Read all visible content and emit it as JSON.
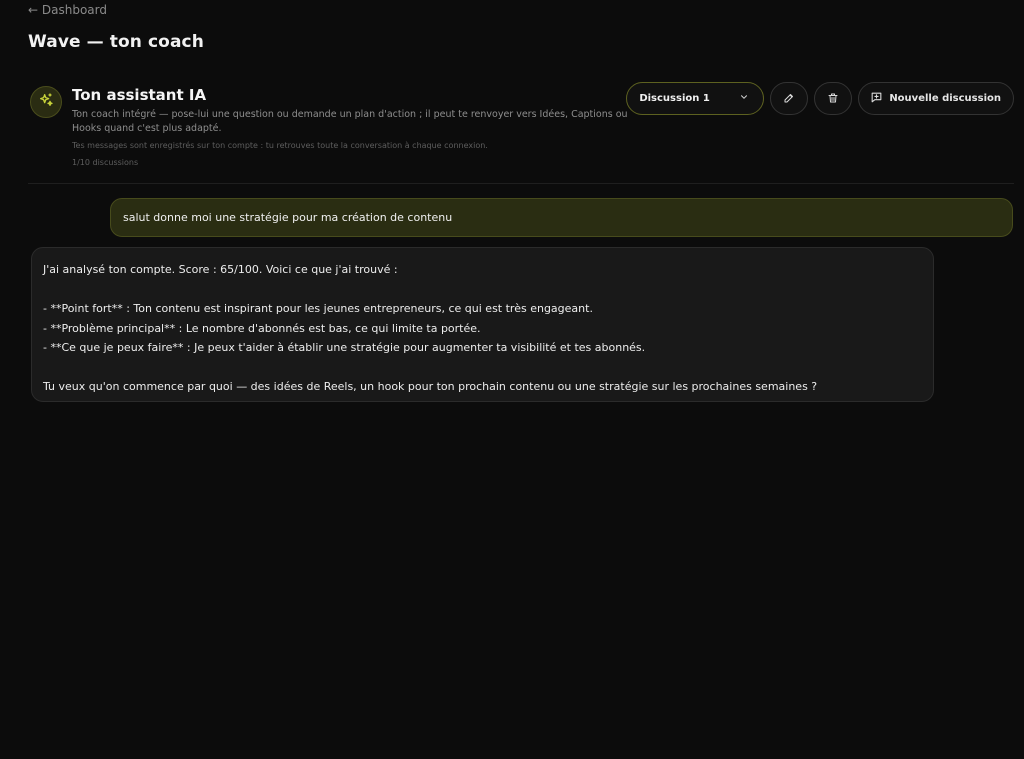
{
  "nav": {
    "back_label": "← Dashboard"
  },
  "page": {
    "title": "Wave — ton coach"
  },
  "assistant": {
    "name": "Ton assistant IA",
    "description": "Ton coach intégré — pose-lui une question ou demande un plan d'action ; il peut te renvoyer vers Idées, Captions ou Hooks quand c'est plus adapté.",
    "storage_note": "Tes messages sont enregistrés sur ton compte : tu retrouves toute la conversation à chaque connexion.",
    "discussion_count": "1/10 discussions",
    "icon": "sparkles-icon"
  },
  "controls": {
    "selected_discussion": "Discussion 1",
    "new_discussion_label": "Nouvelle discussion",
    "edit_icon": "pencil-icon",
    "delete_icon": "trash-icon"
  },
  "messages": {
    "user": "salut donne moi une stratégie pour ma création de contenu",
    "assistant": {
      "intro": "J'ai analysé ton compte. Score : 65/100. Voici ce que j'ai trouvé :",
      "point1": "- **Point fort** : Ton contenu est inspirant pour les jeunes entrepreneurs, ce qui est très engageant.",
      "point2": "- **Problème principal** : Le nombre d'abonnés est bas, ce qui limite ta portée.",
      "point3": "- **Ce que je peux faire** : Je peux t'aider à établir une stratégie pour augmenter ta visibilité et tes abonnés.",
      "question": "Tu veux qu'on commence par quoi — des idées de Reels, un hook pour ton prochain contenu ou une stratégie sur les prochaines semaines ?"
    }
  },
  "colors": {
    "accent": "#c9d43a",
    "user_bubble": "#2a2d12",
    "assistant_bubble": "#191919",
    "background": "#0c0c0c"
  }
}
